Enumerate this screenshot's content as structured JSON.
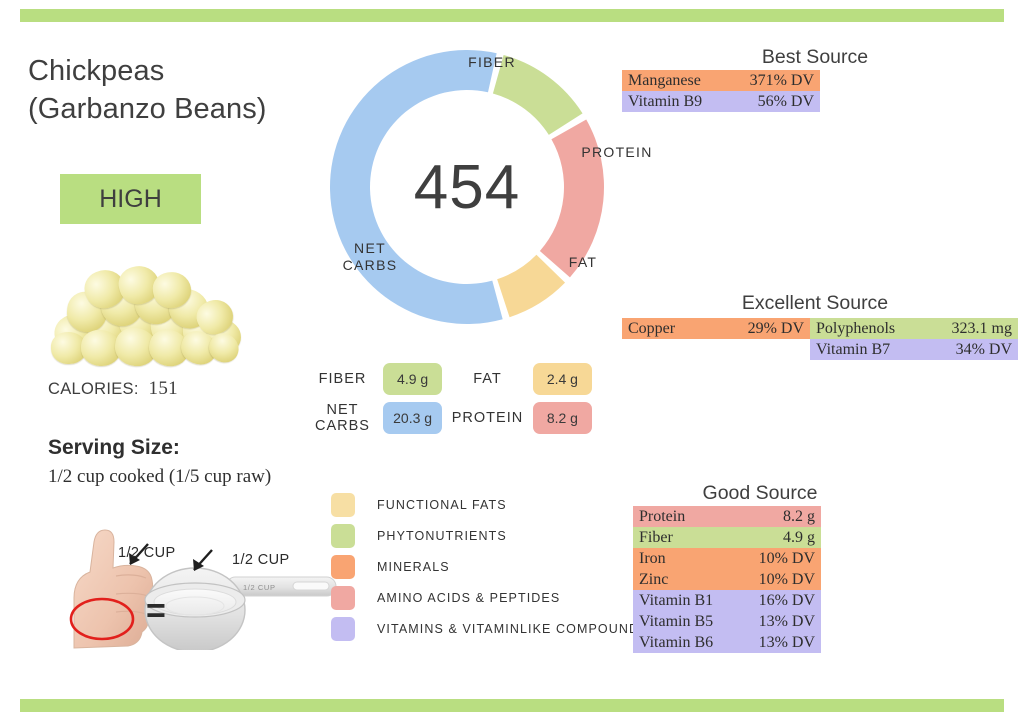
{
  "decor": {
    "bar_color": "#b9de81"
  },
  "header": {
    "title_line1": "Chickpeas",
    "title_line2": "(Garbanzo Beans)",
    "badge": "HIGH"
  },
  "calories": {
    "label": "CALORIES:",
    "value": "151"
  },
  "serving": {
    "title": "Serving Size:",
    "text": "1/2 cup cooked (1/5 cup raw)",
    "hand_note": "1/2 CUP",
    "cup_note": "1/2 CUP",
    "cup_handle_text": "1/2  CUP",
    "equals": "="
  },
  "chart_data": {
    "type": "pie",
    "title": "454",
    "center_value": "454",
    "subtype": "donut",
    "categories": [
      "FIBER",
      "PROTEIN",
      "FAT",
      "NET CARBS"
    ],
    "values": [
      12.5,
      20.5,
      8.5,
      58.5
    ],
    "unit": "percent of ring",
    "colors": [
      "#cade96",
      "#f0a8a2",
      "#f7d896",
      "#a6caf0"
    ],
    "labels": {
      "fiber": "FIBER",
      "protein": "PROTEIN",
      "fat": "FAT",
      "net_carbs_line1": "NET",
      "net_carbs_line2": "CARBS"
    },
    "legend_position": "below-left",
    "grid": false
  },
  "macros": {
    "rows": [
      {
        "name": "FIBER",
        "value": "4.9 g",
        "color": "#cade96",
        "name2": "FAT",
        "value2": "2.4 g",
        "color2": "#f7d896"
      },
      {
        "name": "NET\nCARBS",
        "name_line1": "NET",
        "name_line2": "CARBS",
        "value": "20.3 g",
        "color": "#a6caf0",
        "name2": "PROTEIN",
        "value2": "8.2 g",
        "color2": "#f0a8a2"
      }
    ]
  },
  "legend": {
    "items": [
      {
        "label": "FUNCTIONAL  FATS",
        "color": "#f7dfa4"
      },
      {
        "label": "PHYTONUTRIENTS",
        "color": "#cade96"
      },
      {
        "label": "MINERALS",
        "color": "#f9a472"
      },
      {
        "label": "AMINO ACIDS & PEPTIDES",
        "color": "#f0a8a2"
      },
      {
        "label": "VITAMINS & VITAMINLIKE COMPOUNDS",
        "color": "#c3bdf2"
      }
    ]
  },
  "best_source": {
    "heading": "Best Source",
    "rows": [
      {
        "name": "Manganese",
        "value": "371% DV",
        "color": "#f9a472"
      },
      {
        "name": "Vitamin B9",
        "value": "56% DV",
        "color": "#c3bdf2"
      }
    ]
  },
  "excellent_source": {
    "heading": "Excellent Source",
    "left_rows": [
      {
        "name": "Copper",
        "value": "29% DV",
        "color": "#f9a472"
      }
    ],
    "right_rows": [
      {
        "name": "Polyphenols",
        "value": "323.1 mg",
        "color": "#cade96"
      },
      {
        "name": "Vitamin B7",
        "value": "34% DV",
        "color": "#c3bdf2"
      }
    ]
  },
  "good_source": {
    "heading": "Good Source",
    "rows": [
      {
        "name": "Protein",
        "value": "8.2 g",
        "color": "#f0a8a2"
      },
      {
        "name": "Fiber",
        "value": "4.9 g",
        "color": "#cade96"
      },
      {
        "name": "Iron",
        "value": "10% DV",
        "color": "#f9a472"
      },
      {
        "name": "Zinc",
        "value": "10% DV",
        "color": "#f9a472"
      },
      {
        "name": "Vitamin B1",
        "value": "16% DV",
        "color": "#c3bdf2"
      },
      {
        "name": "Vitamin B5",
        "value": "13% DV",
        "color": "#c3bdf2"
      },
      {
        "name": "Vitamin B6",
        "value": "13% DV",
        "color": "#c3bdf2"
      }
    ]
  }
}
